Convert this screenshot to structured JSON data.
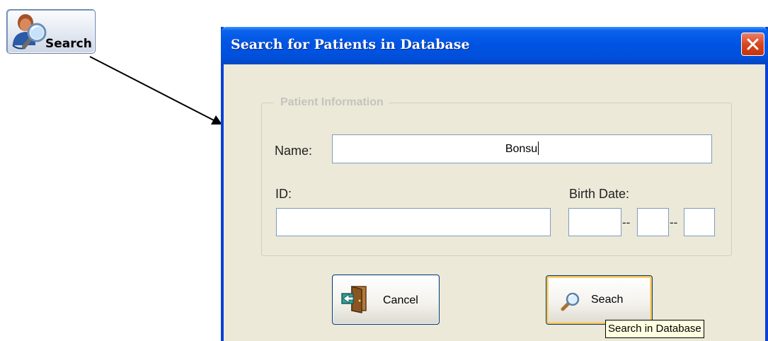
{
  "toolbar": {
    "search_label": "Search"
  },
  "dialog": {
    "title": "Search for Patients in Database",
    "group_title": "Patient Information",
    "name_label": "Name:",
    "name_value": "Bonsu",
    "id_label": "ID:",
    "id_value": "",
    "birth_date_label": "Birth Date:",
    "birth_date_separator": "--",
    "birth_date_parts": [
      "",
      "",
      ""
    ],
    "cancel_label": "Cancel",
    "search_label": "Seach",
    "search_tooltip": "Search in Database"
  },
  "colors": {
    "titlebar": "#0054e3",
    "dialog_background": "#ece9d8",
    "close_button": "#d9471f",
    "field_border": "#7f9db9",
    "tooltip_background": "#ffffe1"
  },
  "icons": {
    "toolbar_search": "person-magnifier-icon",
    "close": "close-icon",
    "cancel": "exit-door-icon",
    "search": "magnifier-icon"
  }
}
